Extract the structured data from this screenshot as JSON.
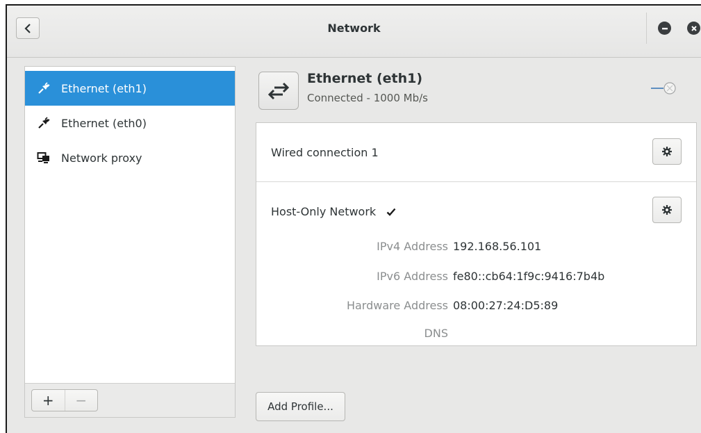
{
  "window": {
    "title": "Network"
  },
  "sidebar": {
    "items": [
      {
        "label": "Ethernet (eth1)",
        "icon": "ethernet-plug-icon",
        "selected": true
      },
      {
        "label": "Ethernet (eth0)",
        "icon": "ethernet-plug-icon",
        "selected": false
      },
      {
        "label": "Network proxy",
        "icon": "network-proxy-icon",
        "selected": false
      }
    ],
    "add_label": "+",
    "remove_label": "−"
  },
  "interface": {
    "name": "Ethernet (eth1)",
    "status": "Connected - 1000 Mb/s",
    "icon": "network-transfer-arrows-icon",
    "switch_on": false
  },
  "connections": [
    {
      "name": "Wired connection 1",
      "active": false
    },
    {
      "name": "Host-Only Network",
      "active": true,
      "details": [
        {
          "label": "IPv4 Address",
          "value": "192.168.56.101"
        },
        {
          "label": "IPv6 Address",
          "value": "fe80::cb64:1f9c:9416:7b4b"
        },
        {
          "label": "Hardware Address",
          "value": "08:00:27:24:D5:89"
        },
        {
          "label": "DNS",
          "value": ""
        }
      ]
    }
  ],
  "add_profile_label": "Add Profile...",
  "colors": {
    "accent": "#2a90d9",
    "window_bg": "#e8e8e7",
    "text": "#2e3436"
  }
}
